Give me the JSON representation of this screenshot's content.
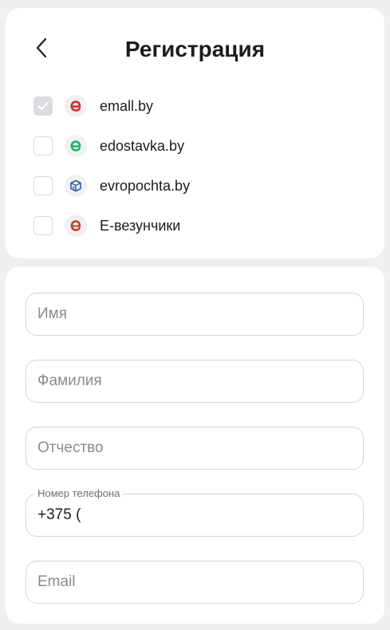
{
  "header": {
    "title": "Регистрация"
  },
  "sites": [
    {
      "label": "emall.by",
      "checked": true,
      "icon": "emall-logo-icon",
      "color": "#e0222b"
    },
    {
      "label": "edostavka.by",
      "checked": false,
      "icon": "edostavka-logo-icon",
      "color": "#17b26a"
    },
    {
      "label": "evropochta.by",
      "checked": false,
      "icon": "evropochta-logo-icon",
      "color": "#1f5fae"
    },
    {
      "label": "Е-везунчики",
      "checked": false,
      "icon": "e-vezunchiki-logo-icon",
      "color": "#c0392b"
    }
  ],
  "form": {
    "first_name": {
      "placeholder": "Имя",
      "value": ""
    },
    "last_name": {
      "placeholder": "Фамилия",
      "value": ""
    },
    "middle_name": {
      "placeholder": "Отчество",
      "value": ""
    },
    "phone": {
      "label": "Номер телефона",
      "value": "+375 ("
    },
    "email": {
      "placeholder": "Email",
      "value": ""
    }
  }
}
